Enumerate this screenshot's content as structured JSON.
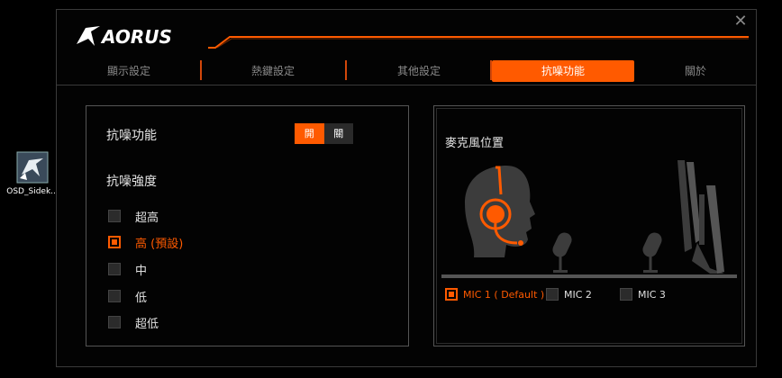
{
  "desktop": {
    "icon_label": "OSD_Sidek..."
  },
  "window": {
    "logo_text": "AORUS",
    "close_glyph": "✕",
    "tabs": [
      {
        "label": "顯示設定",
        "active": false
      },
      {
        "label": "熱鍵設定",
        "active": false
      },
      {
        "label": "其他設定",
        "active": false
      },
      {
        "label": "抗噪功能",
        "active": true
      },
      {
        "label": "關於",
        "active": false
      }
    ]
  },
  "noise": {
    "title": "抗噪功能",
    "toggle": {
      "on_label": "開",
      "off_label": "關",
      "state": "on"
    },
    "strength_title": "抗噪強度",
    "options": [
      {
        "label": "超高",
        "selected": false
      },
      {
        "label": "高 (預設)",
        "selected": true
      },
      {
        "label": "中",
        "selected": false
      },
      {
        "label": "低",
        "selected": false
      },
      {
        "label": "超低",
        "selected": false
      }
    ]
  },
  "mic": {
    "title": "麥克風位置",
    "options": [
      {
        "label": "MIC 1 ( Default )",
        "selected": true
      },
      {
        "label": "MIC 2",
        "selected": false
      },
      {
        "label": "MIC 3",
        "selected": false
      }
    ]
  },
  "colors": {
    "accent": "#ff5a00",
    "panel_border": "#555555",
    "background": "#030303"
  }
}
